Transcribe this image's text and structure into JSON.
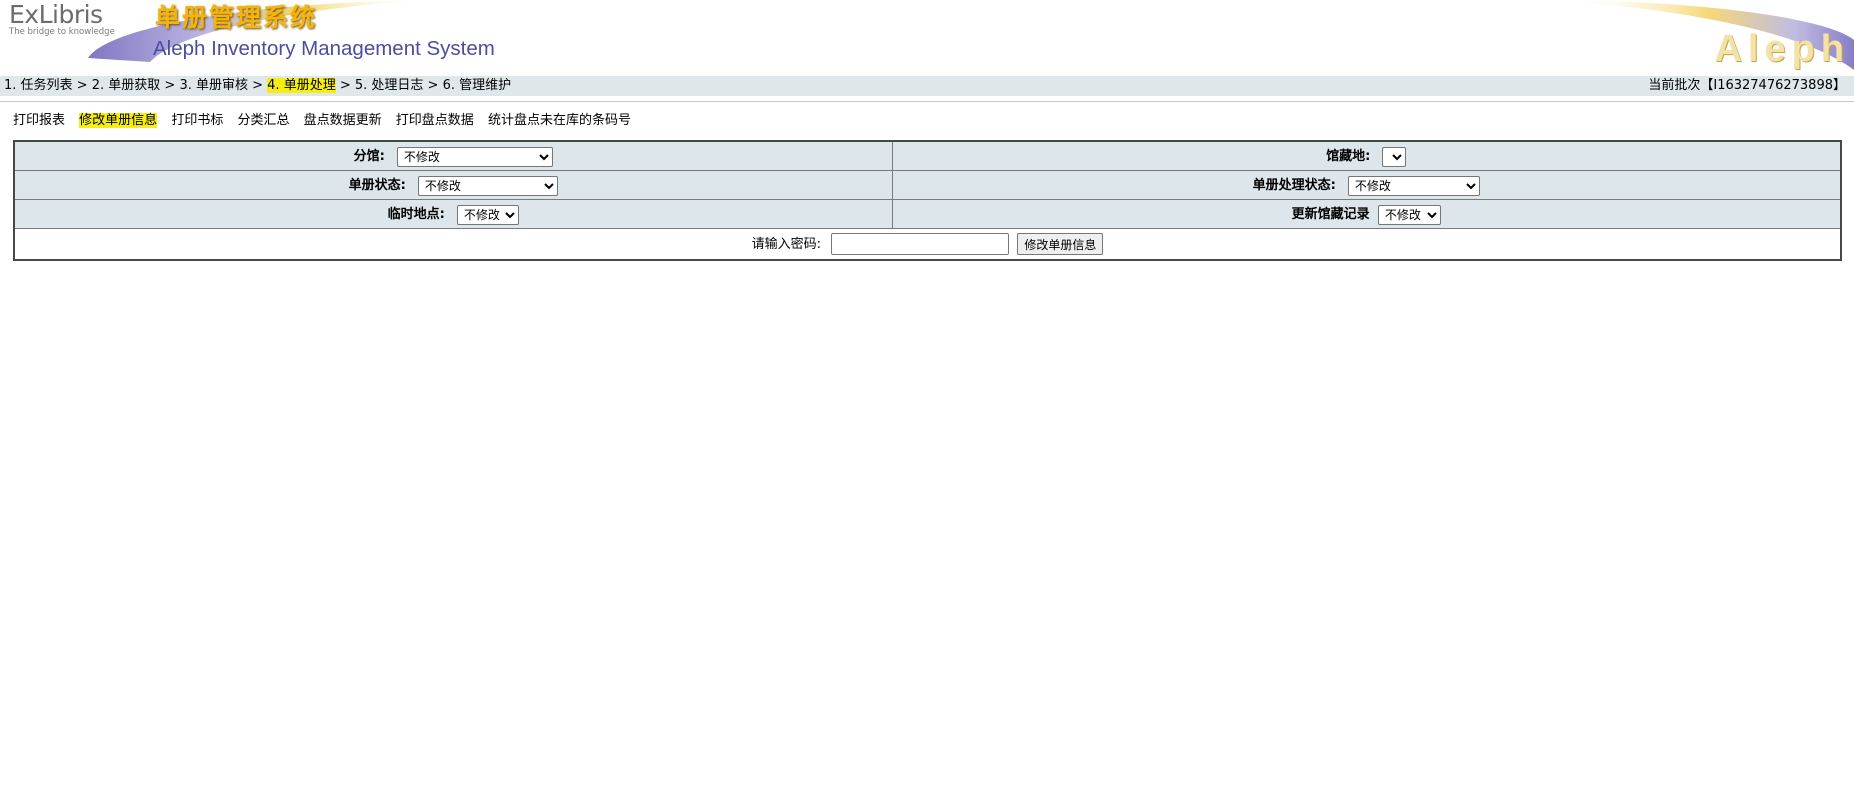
{
  "header": {
    "brand_name": "ExLibris",
    "brand_tagline": "The bridge to knowledge",
    "title_cn": "单册管理系统",
    "title_en": "Aleph Inventory Management System",
    "aleph_word": "Aleph"
  },
  "breadcrumb": {
    "steps": [
      "1. 任务列表",
      "2. 单册获取",
      "3. 单册审核",
      "4. 单册处理",
      "5. 处理日志",
      "6. 管理维护"
    ],
    "separator": " > ",
    "active_index": 3,
    "batch": "当前批次【I16327476273898】"
  },
  "menu": {
    "items": [
      "打印报表",
      "修改单册信息",
      "打印书标",
      "分类汇总",
      "盘点数据更新",
      "打印盘点数据",
      "统计盘点未在库的条码号"
    ],
    "active_index": 1
  },
  "form": {
    "branch": {
      "label": "分馆:",
      "value": "不修改"
    },
    "collection": {
      "label": "馆藏地:",
      "value": ""
    },
    "item_status": {
      "label": "单册状态:",
      "value": "不修改"
    },
    "process_status": {
      "label": "单册处理状态:",
      "value": "不修改"
    },
    "temp_location": {
      "label": "临时地点:",
      "value": "不修改"
    },
    "update_holdings": {
      "label": "更新馆藏记录",
      "value": "不修改"
    },
    "password_label": "请输入密码:",
    "password_value": "",
    "submit_label": "修改单册信息"
  },
  "colors": {
    "highlight": "#f5ed14",
    "bar_bg": "#dfe7ea",
    "cell_bg": "#dde6ea",
    "title_cn": "#f6b30a",
    "title_en": "#4a4e9c"
  }
}
